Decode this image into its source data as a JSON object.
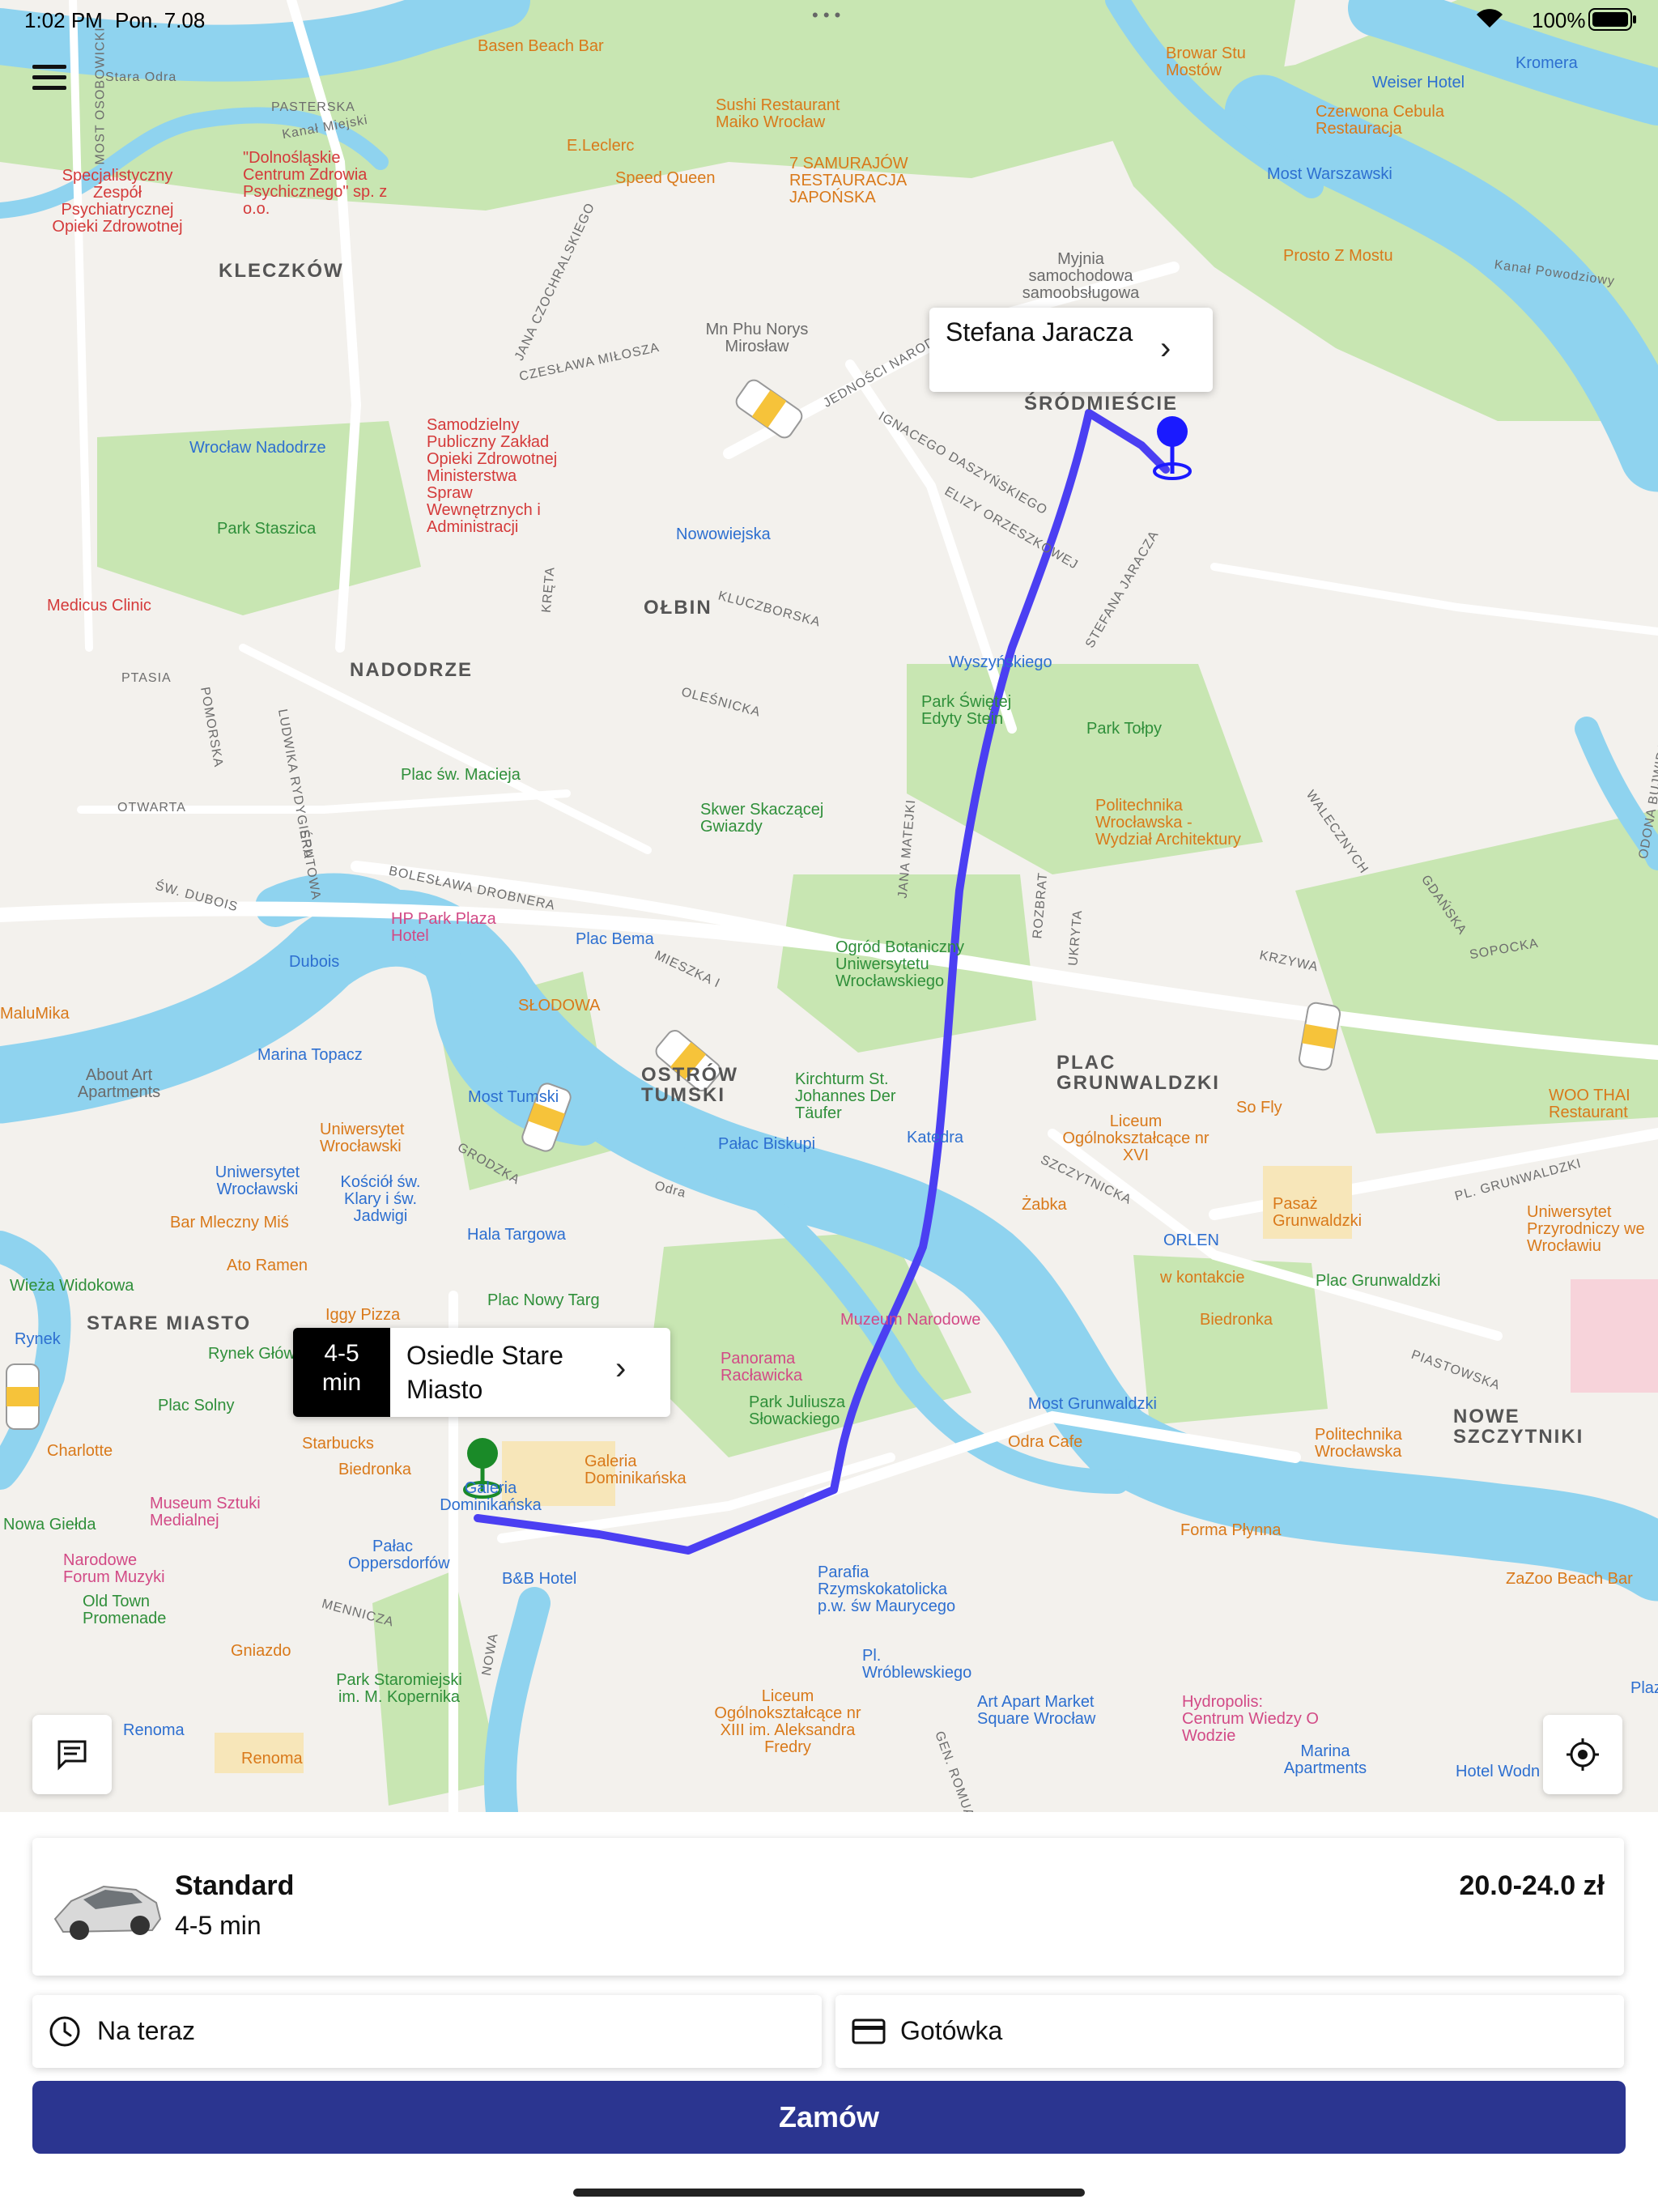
{
  "status_bar": {
    "time": "1:02 PM",
    "date": "Pon. 7.08",
    "battery": "100%"
  },
  "map": {
    "districts": [
      "KLECZKÓW",
      "NADODRZE",
      "OŁBIN",
      "ŚRÓDMIEŚCIE",
      "OSTRÓW TUMSKI",
      "PLAC GRUNWALDZKI",
      "STARE MIASTO",
      "NOWE SZCZYTNIKI"
    ],
    "pois": [
      {
        "text": "Basen Beach Bar",
        "color": "orange"
      },
      {
        "text": "Sushi Restaurant Maiko Wrocław",
        "color": "orange"
      },
      {
        "text": "E.Leclerc",
        "color": "orange"
      },
      {
        "text": "Speed Queen",
        "color": "orange"
      },
      {
        "text": "7 SAMURAJÓW RESTAURACJA JAPOŃSKA",
        "color": "orange"
      },
      {
        "text": "Browar Stu Mostów",
        "color": "orange"
      },
      {
        "text": "Czerwona Cebula Restauracja",
        "color": "orange"
      },
      {
        "text": "Most Warszawski",
        "color": "blue"
      },
      {
        "text": "Prosto Z Mostu",
        "color": "orange"
      },
      {
        "text": "Weiser Hotel",
        "color": "blue"
      },
      {
        "text": "Kromera",
        "color": "blue"
      },
      {
        "text": "Specjalistyczny Zespół Psychiatrycznej Opieki Zdrowotnej",
        "color": "red"
      },
      {
        "text": "\"Dolnośląskie Centrum Zdrowia Psychicznego\" sp. z o.o.",
        "color": "red"
      },
      {
        "text": "Myjnia samochodowa samoobsługowa",
        "color": "gray"
      },
      {
        "text": "Mn Phu Norys Mirosław",
        "color": "gray"
      },
      {
        "text": "Wrocław Nadodrze",
        "color": "blue"
      },
      {
        "text": "Samodzielny Publiczny Zakład Opieki Zdrowotnej Ministerstwa Spraw Wewnętrznych i Administracji",
        "color": "red"
      },
      {
        "text": "Nowowiejska",
        "color": "blue"
      },
      {
        "text": "Park Staszica",
        "color": "green"
      },
      {
        "text": "Medicus Clinic",
        "color": "red"
      },
      {
        "text": "Wyszyńskiego",
        "color": "blue"
      },
      {
        "text": "Park Świętej Edyty Stein",
        "color": "green"
      },
      {
        "text": "Park Tołpy",
        "color": "green"
      },
      {
        "text": "Plac św. Macieja",
        "color": "green"
      },
      {
        "text": "Skwer Skaczącej Gwiazdy",
        "color": "green"
      },
      {
        "text": "Politechnika Wrocławska - Wydział Architektury",
        "color": "orange"
      },
      {
        "text": "HP Park Plaza Hotel",
        "color": "purple"
      },
      {
        "text": "Dubois",
        "color": "blue"
      },
      {
        "text": "Plac Bema",
        "color": "blue"
      },
      {
        "text": "Ogród Botaniczny Uniwersytetu Wrocławskiego",
        "color": "green"
      },
      {
        "text": "MaluMika",
        "color": "orange"
      },
      {
        "text": "SŁODOWA",
        "color": "orange"
      },
      {
        "text": "Marina Topacz",
        "color": "blue"
      },
      {
        "text": "About Art Apartments",
        "color": "gray"
      },
      {
        "text": "Most Tumski",
        "color": "blue"
      },
      {
        "text": "Kirchturm St. Johannes Der Täufer",
        "color": "green"
      },
      {
        "text": "Pałac Biskupi",
        "color": "blue"
      },
      {
        "text": "Katedra",
        "color": "blue"
      },
      {
        "text": "So Fly",
        "color": "orange"
      },
      {
        "text": "Liceum Ogólnokształcące nr XVI",
        "color": "orange"
      },
      {
        "text": "WOO THAI Restaurant",
        "color": "orange"
      },
      {
        "text": "Uniwersytet Wrocławski",
        "color": "orange"
      },
      {
        "text": "Uniwersytet Wrocławski",
        "color": "blue"
      },
      {
        "text": "Kościół św. Klary i św. Jadwigi",
        "color": "blue"
      },
      {
        "text": "Bar Mleczny Miś",
        "color": "orange"
      },
      {
        "text": "Hala Targowa",
        "color": "blue"
      },
      {
        "text": "Żabka",
        "color": "orange"
      },
      {
        "text": "Pasaż Grunwaldzki",
        "color": "orange"
      },
      {
        "text": "ORLEN",
        "color": "blue"
      },
      {
        "text": "Uniwersytet Przyrodniczy we Wrocławiu",
        "color": "orange"
      },
      {
        "text": "Ato Ramen",
        "color": "orange"
      },
      {
        "text": "Wieża Widokowa",
        "color": "green"
      },
      {
        "text": "Iggy Pizza",
        "color": "orange"
      },
      {
        "text": "Plac Nowy Targ",
        "color": "green"
      },
      {
        "text": "w kontakcie",
        "color": "orange"
      },
      {
        "text": "Plac Grunwaldzki",
        "color": "green"
      },
      {
        "text": "Muzeum Narodowe",
        "color": "pink"
      },
      {
        "text": "Biedronka",
        "color": "orange"
      },
      {
        "text": "Rynek",
        "color": "blue"
      },
      {
        "text": "Rynek Główny",
        "color": "green"
      },
      {
        "text": "Panorama Racławicka",
        "color": "pink"
      },
      {
        "text": "Most Grunwaldzki",
        "color": "blue"
      },
      {
        "text": "Plac Solny",
        "color": "green"
      },
      {
        "text": "Park Juliusza Słowackiego",
        "color": "green"
      },
      {
        "text": "Starbucks",
        "color": "orange"
      },
      {
        "text": "Charlotte",
        "color": "orange"
      },
      {
        "text": "Biedronka",
        "color": "orange"
      },
      {
        "text": "Galeria Dominikańska",
        "color": "orange"
      },
      {
        "text": "Odra Cafe",
        "color": "orange"
      },
      {
        "text": "Politechnika Wrocławska",
        "color": "orange"
      },
      {
        "text": "Museum Sztuki Medialnej",
        "color": "pink"
      },
      {
        "text": "Forma Płynna",
        "color": "orange"
      },
      {
        "text": "Nowa Giełda",
        "color": "green"
      },
      {
        "text": "Narodowe Forum Muzyki",
        "color": "pink"
      },
      {
        "text": "Pałac Oppersdorfów",
        "color": "blue"
      },
      {
        "text": "B&B Hotel",
        "color": "blue"
      },
      {
        "text": "Old Town Promenade",
        "color": "green"
      },
      {
        "text": "Parafia Rzymskokatolicka p.w. św Maurycego",
        "color": "blue"
      },
      {
        "text": "ZaZoo Beach Bar",
        "color": "orange"
      },
      {
        "text": "Gniazdo",
        "color": "orange"
      },
      {
        "text": "Pl. Wróblewskiego",
        "color": "blue"
      },
      {
        "text": "Park Staromiejski im. M. Kopernika",
        "color": "green"
      },
      {
        "text": "Art Apart Market Square Wrocław",
        "color": "purple"
      },
      {
        "text": "Hydropolis: Centrum Wiedzy O Wodzie",
        "color": "pink"
      },
      {
        "text": "Marina Apartments",
        "color": "purple"
      },
      {
        "text": "Plaza",
        "color": "blue"
      },
      {
        "text": "Liceum Ogólnokształcące nr XIII im. Aleksandra Fredry",
        "color": "orange"
      },
      {
        "text": "Renoma",
        "color": "blue"
      },
      {
        "text": "Renoma",
        "color": "orange"
      },
      {
        "text": "Hotel Wodn",
        "color": "blue"
      }
    ],
    "streets": [
      "Stara Odra",
      "PASTERSKA",
      "Kanał Miejski",
      "Kanał Powodziowy",
      "JEDNOŚCI NARODOWEJ",
      "IGNACEGO DASZYŃSKIEGO",
      "ELIZY ORZESZKOWEJ",
      "STEFANA JARACZA",
      "KLUCZBORSKA",
      "OLEŚNICKA",
      "PTASIA",
      "POMORSKA",
      "OTWARTA",
      "BOLESŁAWA DROBNERA",
      "ŚW. DUBOIS",
      "MIESZKA I",
      "JANA MATEJKI",
      "ROZBRAT",
      "UKRYTA",
      "KRZYWA",
      "SZCZYTNICKA",
      "PL. GRUNWALDZKI",
      "GRODZKA",
      "Odra",
      "PIASTOWSKA",
      "NOWA",
      "MENNICZA",
      "GEN. ROMUALDA",
      "MOST OSOBOWICKI",
      "CZESŁAWA MIŁOSZA",
      "JANA CZOCHRALSKIEGO",
      "KRĘTA",
      "ŚRUTOWA",
      "LUDWIKA RYDYGIERA",
      "WALECZNYCH",
      "GDAŃSKA",
      "SOPOCKA",
      "ODONA BUJWIDA"
    ],
    "destination_callout": {
      "label": "Stefana Jaracza"
    },
    "pickup_callout": {
      "eta": "4-5 min",
      "label": "Osiedle Stare Miasto"
    },
    "pickup_marker_label": "Galeria Dominikańska",
    "taxi_badge": "TAXI",
    "route_color": "#4b3ff2",
    "pickup_color": "#1a8a28",
    "destination_color": "#1a1aff"
  },
  "ride": {
    "class_name": "Standard",
    "eta": "4-5 min",
    "price": "20.0-24.0 zł"
  },
  "options": {
    "time_label": "Na teraz",
    "payment_label": "Gotówka"
  },
  "order_button": {
    "label": "Zamów",
    "color": "#2b3590"
  },
  "icons": {
    "menu": "hamburger-icon",
    "chat": "chat-icon",
    "locate": "locate-icon",
    "clock": "clock-icon",
    "card": "credit-card-icon",
    "car": "car-icon"
  }
}
